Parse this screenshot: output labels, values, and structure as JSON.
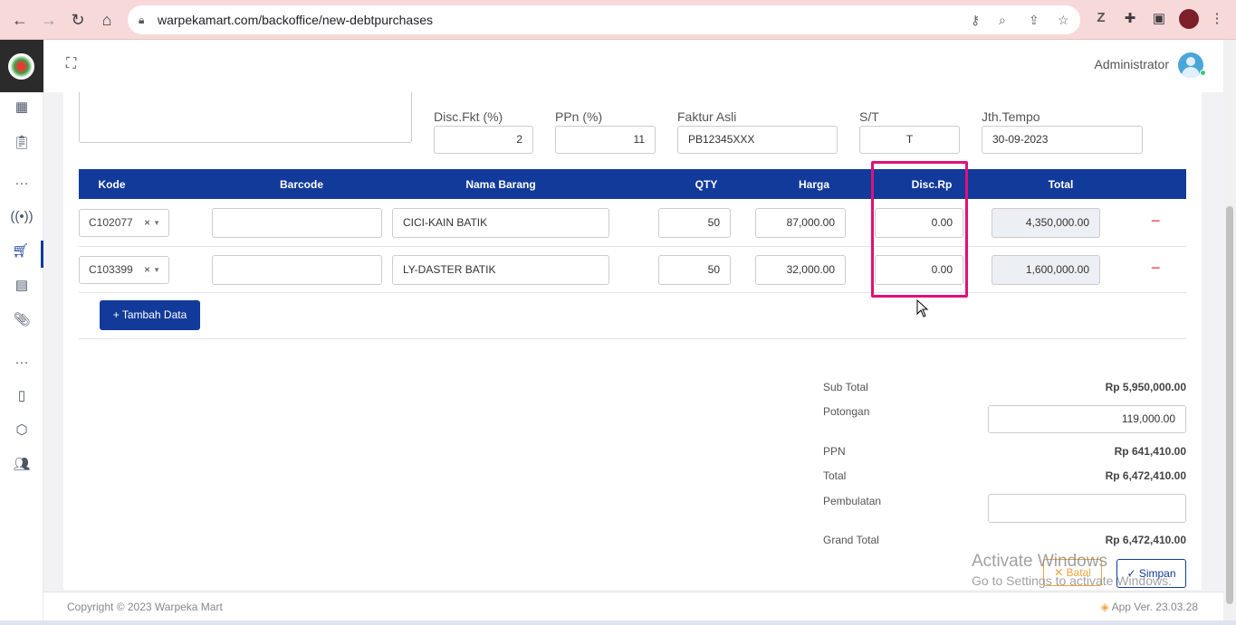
{
  "browser": {
    "url": "warpekamart.com/backoffice/new-debtpurchases"
  },
  "topbar": {
    "user_name": "Administrator"
  },
  "form": {
    "disc_fkt_label": "Disc.Fkt (%)",
    "disc_fkt_value": "2",
    "ppn_label": "PPn (%)",
    "ppn_value": "11",
    "faktur_label": "Faktur Asli",
    "faktur_value": "PB12345XXX",
    "st_label": "S/T",
    "st_value": "T",
    "jth_tempo_label": "Jth.Tempo",
    "jth_tempo_value": "30-09-2023"
  },
  "table": {
    "headers": [
      "Kode",
      "Barcode",
      "Nama Barang",
      "QTY",
      "Harga",
      "Disc.Rp",
      "Total"
    ],
    "rows": [
      {
        "kode": "C102077",
        "barcode": "",
        "nama": "CICI-KAIN BATIK",
        "qty": "50",
        "harga": "87,000.00",
        "disc": "0.00",
        "total": "4,350,000.00"
      },
      {
        "kode": "C103399",
        "barcode": "",
        "nama": "LY-DASTER BATIK",
        "qty": "50",
        "harga": "32,000.00",
        "disc": "0.00",
        "total": "1,600,000.00"
      }
    ],
    "clear_symbol": "×",
    "delete_symbol": "−"
  },
  "add_button": "Tambah Data",
  "summary": {
    "sub_total_label": "Sub Total",
    "sub_total_value": "Rp 5,950,000.00",
    "potongan_label": "Potongan",
    "potongan_value": "119,000.00",
    "ppn_label": "PPN",
    "ppn_value": "Rp 641,410.00",
    "total_label": "Total",
    "total_value": "Rp 6,472,410.00",
    "pembulatan_label": "Pembulatan",
    "pembulatan_value": "",
    "grand_total_label": "Grand Total",
    "grand_total_value": "Rp 6,472,410.00"
  },
  "actions": {
    "batal": "Batal",
    "simpan": "Simpan"
  },
  "watermark": {
    "line1": "Activate Windows",
    "line2": "Go to Settings to activate Windows."
  },
  "footer": {
    "copyright": "Copyright © 2023 Warpeka Mart",
    "version": "App Ver. 23.03.28"
  },
  "colors": {
    "primary": "#123a9a",
    "highlight": "#e0107a",
    "danger": "#e53935",
    "warning": "#f0a33a"
  }
}
